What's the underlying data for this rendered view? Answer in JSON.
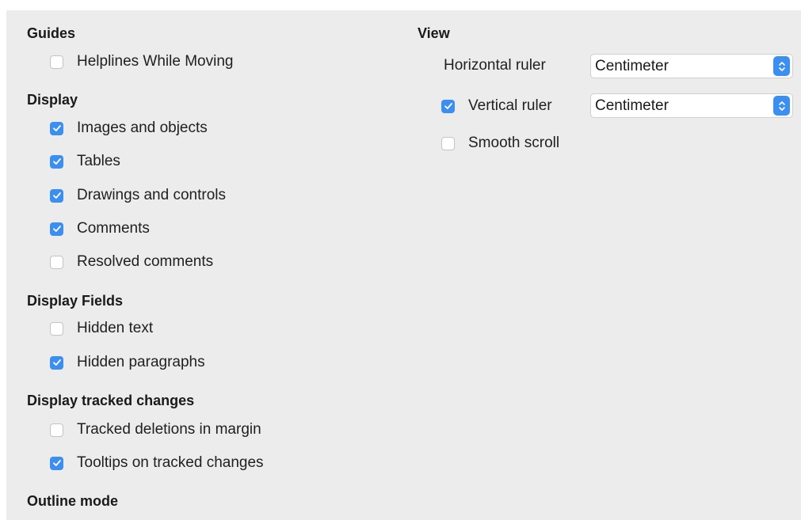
{
  "guides": {
    "heading": "Guides",
    "helplines": {
      "label": "Helplines While Moving",
      "checked": false
    }
  },
  "display": {
    "heading": "Display",
    "items": [
      {
        "label": "Images and objects",
        "checked": true
      },
      {
        "label": "Tables",
        "checked": true
      },
      {
        "label": "Drawings and controls",
        "checked": true
      },
      {
        "label": "Comments",
        "checked": true
      },
      {
        "label": "Resolved comments",
        "checked": false
      }
    ]
  },
  "display_fields": {
    "heading": "Display Fields",
    "items": [
      {
        "label": "Hidden text",
        "checked": false
      },
      {
        "label": "Hidden paragraphs",
        "checked": true
      }
    ]
  },
  "tracked_changes": {
    "heading": "Display tracked changes",
    "items": [
      {
        "label": "Tracked deletions in margin",
        "checked": false
      },
      {
        "label": "Tooltips on tracked changes",
        "checked": true
      }
    ]
  },
  "outline": {
    "heading": "Outline mode"
  },
  "view": {
    "heading": "View",
    "horizontal_ruler": {
      "label": "Horizontal ruler",
      "unit": "Centimeter"
    },
    "vertical_ruler": {
      "label": "Vertical ruler",
      "checked": true,
      "unit": "Centimeter"
    },
    "smooth_scroll": {
      "label": "Smooth scroll",
      "checked": false
    }
  },
  "colors": {
    "accent": "#3b8ff0",
    "panel": "#ececec"
  },
  "icons": {
    "check": "checkmark-icon",
    "stepper": "up-down-chevron-icon"
  }
}
